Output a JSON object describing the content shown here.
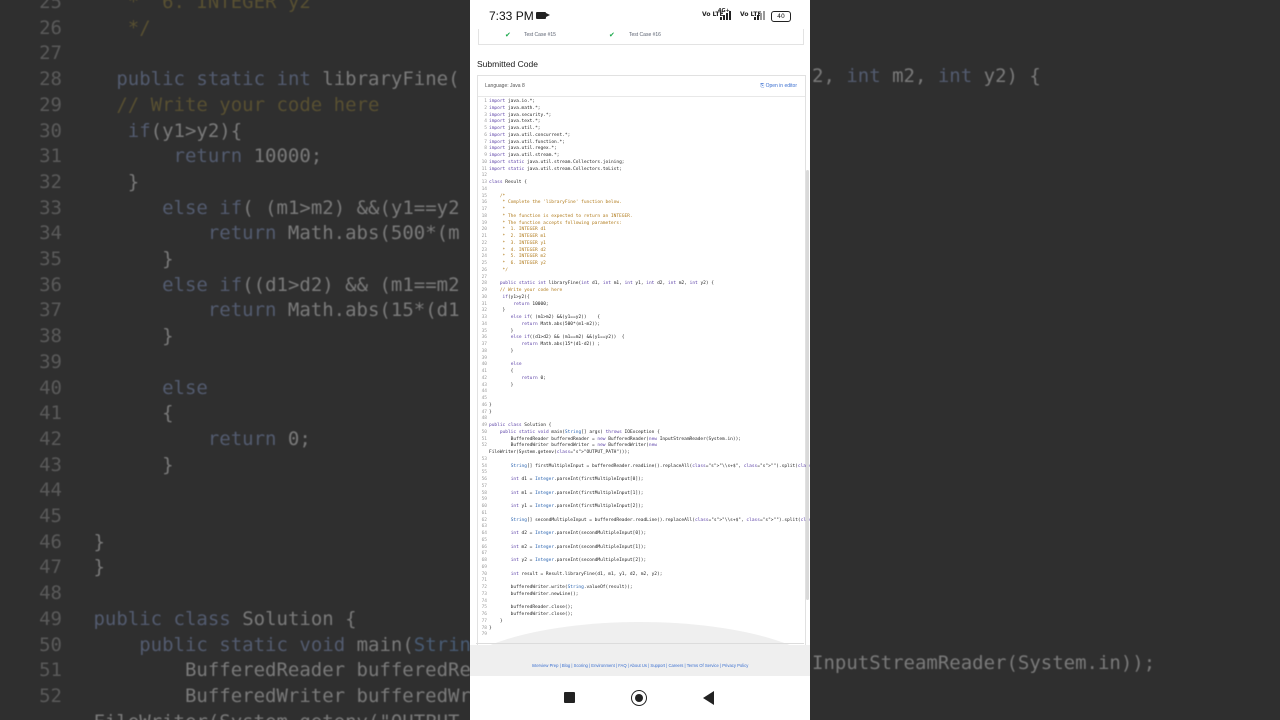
{
  "background_code": [
    {
      "n": "25",
      "text": "    *  6. INTEGER y2"
    },
    {
      "n": "26",
      "text": "    */"
    },
    {
      "n": "27",
      "text": ""
    },
    {
      "n": "28",
      "text": "   public static int libraryFine("
    },
    {
      "n": "29",
      "text": "   // Write your code here"
    },
    {
      "n": "30",
      "text": "    if(y1>y2){"
    },
    {
      "n": "31",
      "text": "        return 10000;"
    },
    {
      "n": "32",
      "text": "    }"
    },
    {
      "n": "33",
      "text": "       else if( (m1>m2) &&(y1==y2"
    },
    {
      "n": "34",
      "text": "           return Math.abs(500*(m"
    },
    {
      "n": "35",
      "text": "       }"
    },
    {
      "n": "36",
      "text": "       else if((d1>d2) && (m1==m2"
    },
    {
      "n": "37",
      "text": "           return Math.abs(15*(d1"
    },
    {
      "n": "38",
      "text": "       }"
    },
    {
      "n": "39",
      "text": ""
    },
    {
      "n": "40",
      "text": "       else"
    },
    {
      "n": "41",
      "text": "       {"
    },
    {
      "n": "42",
      "text": "           return 0;"
    },
    {
      "n": "43",
      "text": "       }"
    },
    {
      "n": "44",
      "text": ""
    },
    {
      "n": "45",
      "text": ""
    },
    {
      "n": "46",
      "text": " }"
    },
    {
      "n": "47",
      "text": " }"
    },
    {
      "n": "48",
      "text": ""
    },
    {
      "n": "49",
      "text": " public class Solution {"
    },
    {
      "n": "50",
      "text": "     public static void main(String"
    },
    {
      "n": "51",
      "text": "         BufferedReader bufferedRea"
    },
    {
      "n": "52",
      "text": "         BufferedWriter bufferedWri"
    },
    {
      "n": "",
      "text": " FileWriter(System.getenv(\"OUTPUT_P"
    }
  ],
  "background_right": [
    {
      "text": "2, int m2, int y2) {"
    },
    {
      "text": "InputStreamReader(System.in));"
    }
  ],
  "status_bar": {
    "time": "7:33 PM",
    "net1": "Vo LTE",
    "net2": "4G+",
    "net3": "Vo LTE",
    "battery": "40"
  },
  "test_cases": {
    "left": "Test Case #15",
    "right": "Test Case #16"
  },
  "section_title": "Submitted Code",
  "editor": {
    "language": "Language: Java 8",
    "open_in_editor": "Open in editor"
  },
  "code_lines": [
    "import java.io.*;",
    "import java.math.*;",
    "import java.security.*;",
    "import java.text.*;",
    "import java.util.*;",
    "import java.util.concurrent.*;",
    "import java.util.function.*;",
    "import java.util.regex.*;",
    "import java.util.stream.*;",
    "import static java.util.stream.Collectors.joining;",
    "import static java.util.stream.Collectors.toList;",
    "",
    "class Result {",
    "",
    "    /*",
    "     * Complete the 'libraryFine' function below.",
    "     *",
    "     * The function is expected to return an INTEGER.",
    "     * The function accepts following parameters:",
    "     *  1. INTEGER d1",
    "     *  2. INTEGER m1",
    "     *  3. INTEGER y1",
    "     *  4. INTEGER d2",
    "     *  5. INTEGER m2",
    "     *  6. INTEGER y2",
    "     */",
    "",
    "    public static int libraryFine(int d1, int m1, int y1, int d2, int m2, int y2) {",
    "    // Write your code here",
    "     if(y1>y2){",
    "         return 10000;",
    "     }",
    "        else if( (m1>m2) &&(y1==y2))    {",
    "            return Math.abs(500*(m1-m2));",
    "        }",
    "        else if((d1>d2) && (m1==m2) &&(y1==y2))  {",
    "            return Math.abs(15*(d1-d2)) ;",
    "        }",
    "",
    "        else",
    "        {",
    "            return 0;",
    "        }",
    "",
    "",
    "}",
    "}",
    "",
    "public class Solution {",
    "    public static void main(String[] args) throws IOException {",
    "        BufferedReader bufferedReader = new BufferedReader(new InputStreamReader(System.in));",
    "        BufferedWriter bufferedWriter = new BufferedWriter(new",
    "FileWriter(System.getenv(\"OUTPUT_PATH\")));",
    "",
    "        String[] firstMultipleInput = bufferedReader.readLine().replaceAll(\"\\\\s+$\", \"\").split(\" \");",
    "",
    "        int d1 = Integer.parseInt(firstMultipleInput[0]);",
    "",
    "        int m1 = Integer.parseInt(firstMultipleInput[1]);",
    "",
    "        int y1 = Integer.parseInt(firstMultipleInput[2]);",
    "",
    "        String[] secondMultipleInput = bufferedReader.readLine().replaceAll(\"\\\\s+$\", \"\").split(\" \");",
    "",
    "        int d2 = Integer.parseInt(secondMultipleInput[0]);",
    "",
    "        int m2 = Integer.parseInt(secondMultipleInput[1]);",
    "",
    "        int y2 = Integer.parseInt(secondMultipleInput[2]);",
    "",
    "        int result = Result.libraryFine(d1, m1, y1, d2, m2, y2);",
    "",
    "        bufferedWriter.write(String.valueOf(result));",
    "        bufferedWriter.newLine();",
    "",
    "        bufferedReader.close();",
    "        bufferedWriter.close();",
    "    }",
    "}",
    ""
  ],
  "code_line_numbers": [
    "1",
    "2",
    "3",
    "4",
    "5",
    "6",
    "7",
    "8",
    "9",
    "10",
    "11",
    "12",
    "13",
    "14",
    "15",
    "16",
    "17",
    "18",
    "19",
    "20",
    "21",
    "22",
    "23",
    "24",
    "25",
    "26",
    "27",
    "28",
    "29",
    "30",
    "31",
    "32",
    "33",
    "34",
    "35",
    "36",
    "37",
    "38",
    "39",
    "40",
    "41",
    "42",
    "43",
    "44",
    "45",
    "46",
    "47",
    "48",
    "49",
    "50",
    "51",
    "52",
    "",
    "53",
    "54",
    "55",
    "56",
    "57",
    "58",
    "59",
    "60",
    "61",
    "62",
    "63",
    "64",
    "65",
    "66",
    "67",
    "68",
    "69",
    "70",
    "71",
    "72",
    "73",
    "74",
    "75",
    "76",
    "77",
    "78",
    "79"
  ],
  "footer_links": "Interview Prep | Blog | Scoring | Environment | FAQ | About Us | Support | Careers | Terms Of Service | Privacy Policy",
  "colors": {
    "check_green": "#1ba94c",
    "link_blue": "#3a6fd0",
    "keyword": "#5a3fa6",
    "comment": "#b07a1a"
  }
}
